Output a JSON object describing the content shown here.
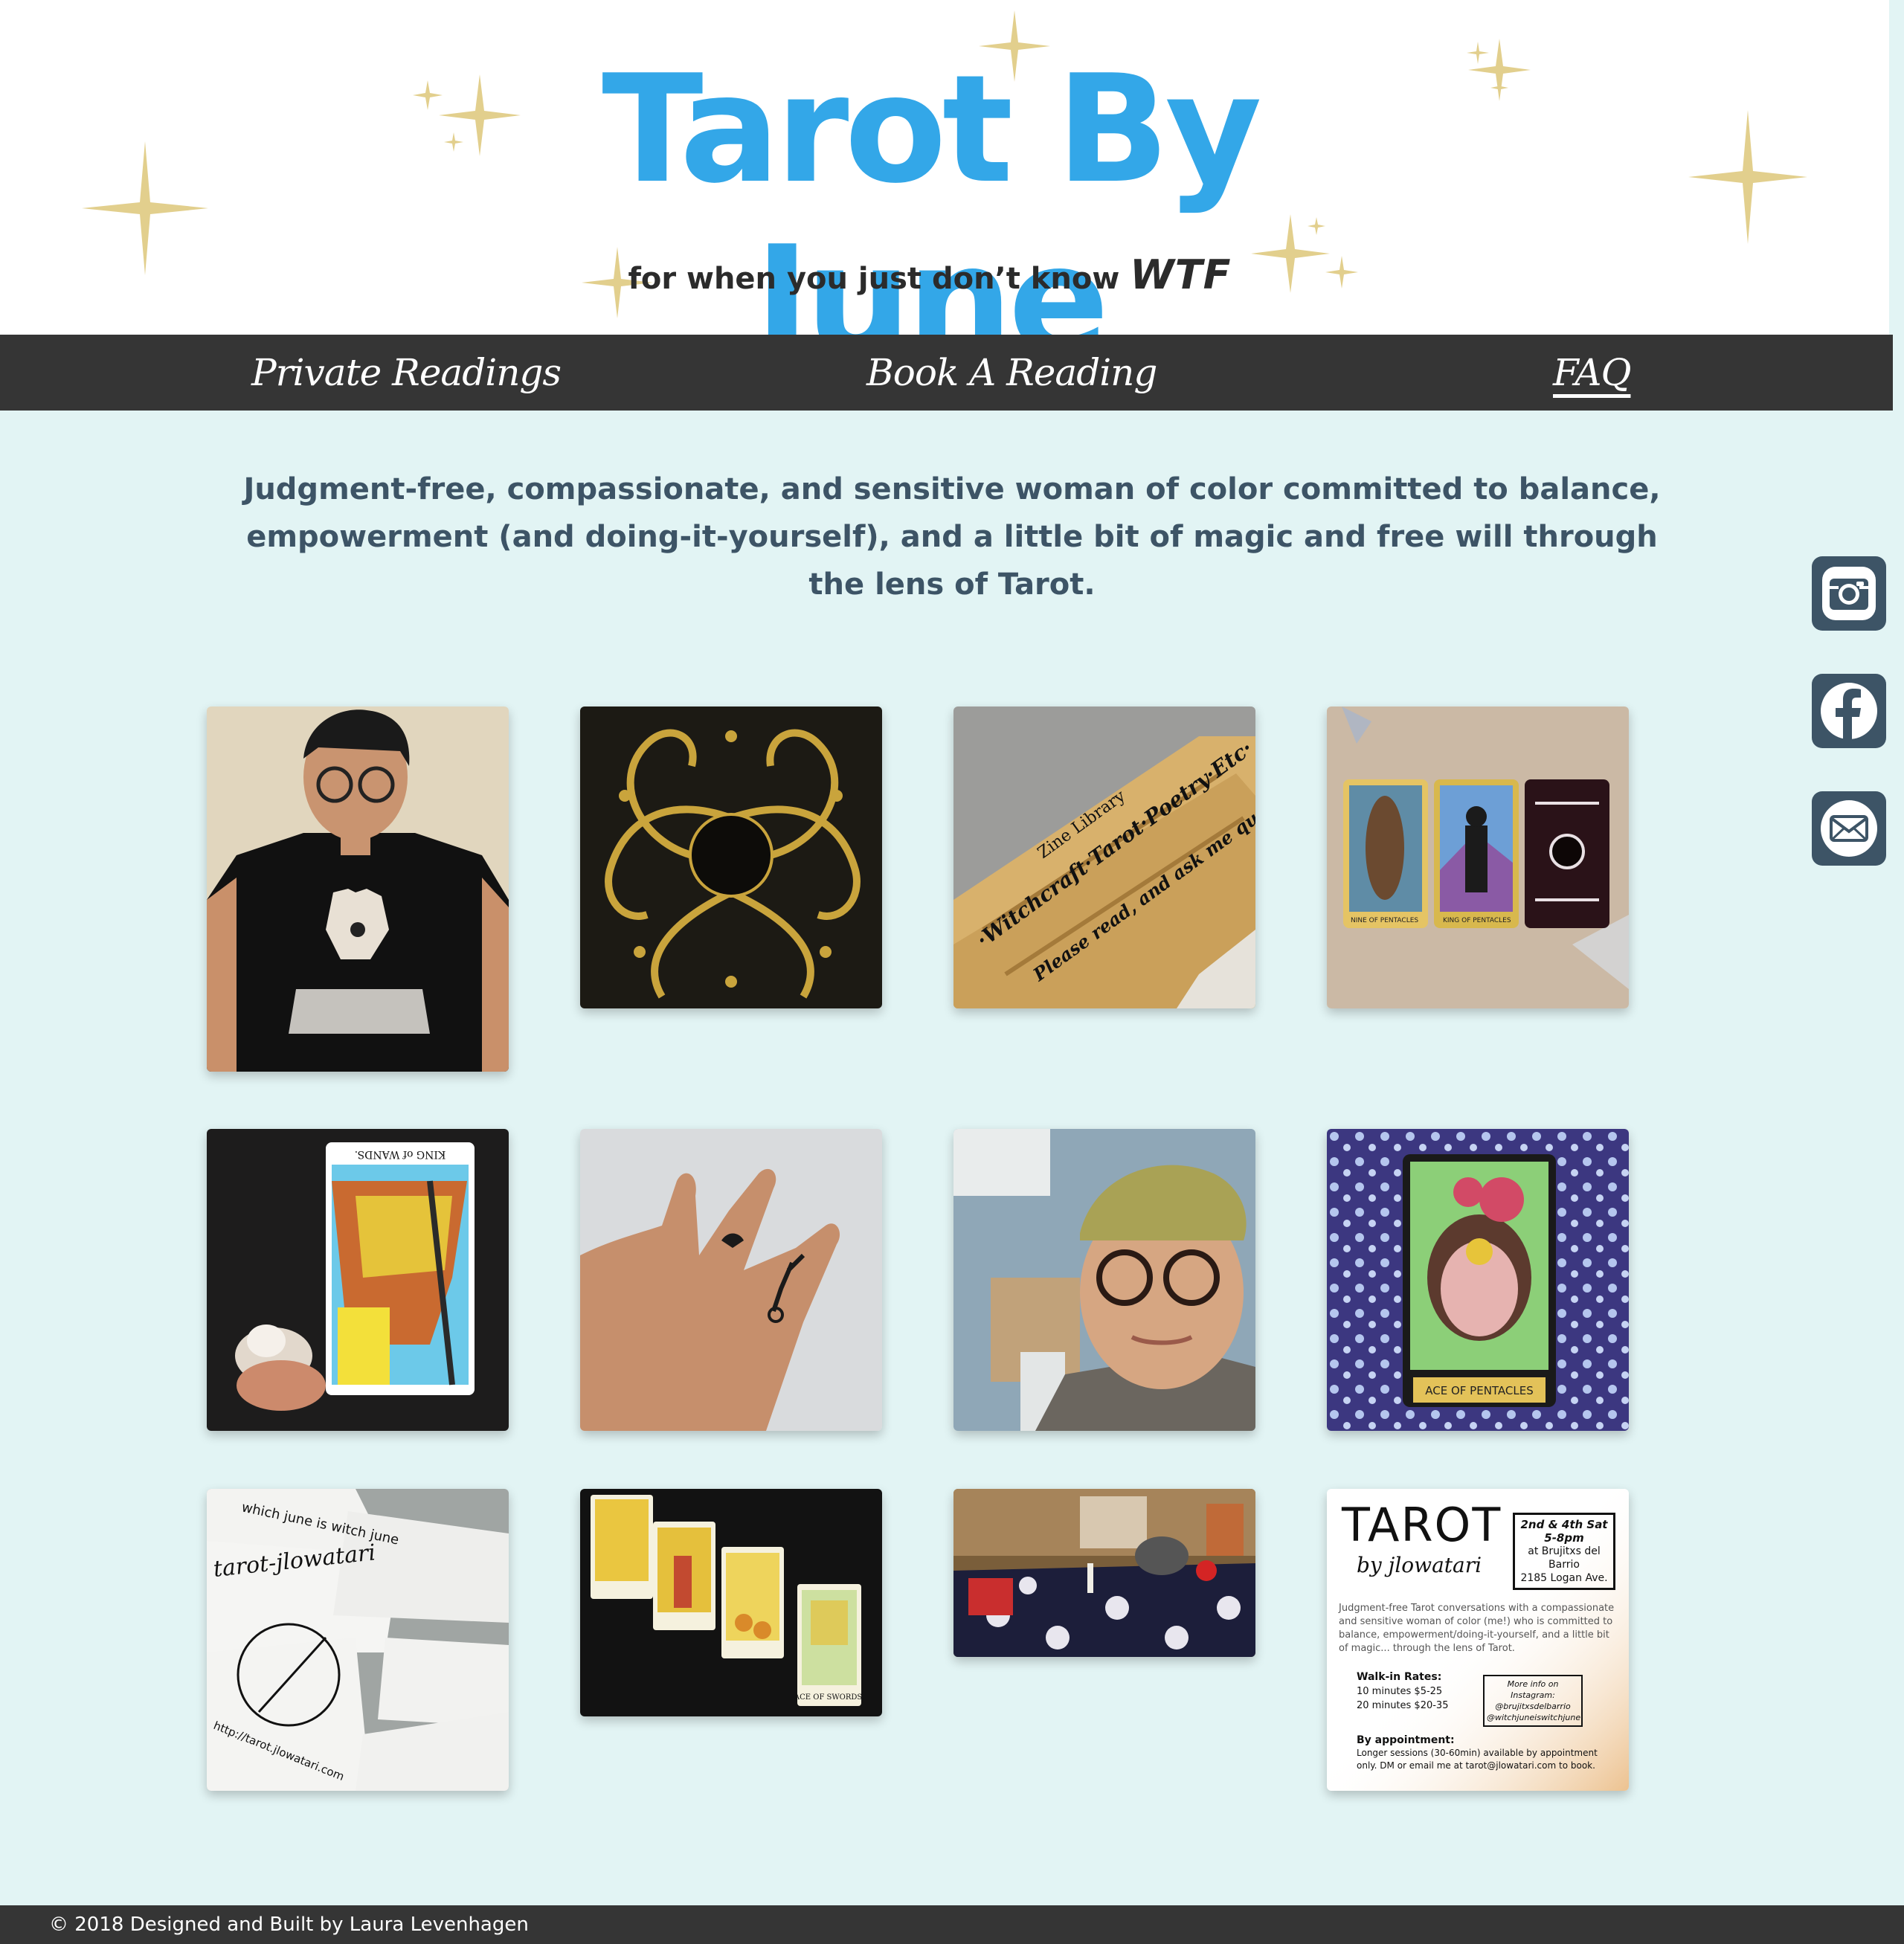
{
  "header": {
    "title": "Tarot By June",
    "tagline": "for when you just don’t know",
    "tagline_emphasis": "WTF",
    "title_color": "#33a7e8",
    "star_color": "#e2cf8d"
  },
  "nav": {
    "items": [
      {
        "label": "Private Readings"
      },
      {
        "label": "Book A Reading"
      },
      {
        "label": "FAQ"
      }
    ]
  },
  "intro": {
    "text": "Judgment-free, compassionate, and sensitive woman of color committed to balance, empowerment (and doing-it-yourself), and a little bit of magic and free will through the lens of Tarot."
  },
  "social": {
    "icons": [
      "instagram-icon",
      "facebook-icon",
      "email-icon"
    ],
    "color": "#3d5466"
  },
  "gallery": {
    "photos": [
      {
        "name": "photo-selfie-hamsa-shirt"
      },
      {
        "name": "photo-gold-card-back"
      },
      {
        "name": "photo-zine-library-sign",
        "text": [
          "Zine Library",
          "·Witchcraft·Tarot·Poetry·Etc·",
          "Please read, and ask me questions!"
        ]
      },
      {
        "name": "photo-three-cards",
        "text": [
          "NINE OF PENTACLES",
          "KING OF PENTACLES"
        ]
      },
      {
        "name": "photo-king-of-wands",
        "text": [
          "KING of WANDS."
        ]
      },
      {
        "name": "photo-finger-tattoos"
      },
      {
        "name": "photo-selfie-beanie"
      },
      {
        "name": "photo-ace-of-pentacles",
        "text": [
          "ACE OF PENTACLES"
        ]
      },
      {
        "name": "photo-business-cards",
        "text": [
          "which june is witch june",
          "tarot-jlowatari",
          "http://tarot.jlowatari.com"
        ]
      },
      {
        "name": "photo-four-cards",
        "text": [
          "ACE OF SWORDS."
        ]
      },
      {
        "name": "photo-altar"
      },
      {
        "name": "photo-event-flyer"
      }
    ],
    "flyer": {
      "title": "TAROT",
      "subtitle": "by jlowatari",
      "dates": "2nd & 4th Sat",
      "time": "5-8pm",
      "venue": "at Brujitxs del Barrio",
      "address": "2185 Logan Ave.",
      "description": "Judgment-free Tarot conversations with a compassionate and sensitive woman of color (me!) who is committed to balance, empowerment/doing-it-yourself, and a little bit of magic... through the lens of Tarot.",
      "walkin_heading": "Walk-in Rates:",
      "rate_10": "10 minutes $5-25",
      "rate_20": "20 minutes $20-35",
      "insta_heading": "More info on Instagram:",
      "insta_1": "@brujitxsdelbarrio",
      "insta_2": "@witchjuneiswitchjune",
      "appt_heading": "By appointment:",
      "appt_text": "Longer sessions (30-60min) available by appointment only. DM or email me at tarot@jlowatari.com to book."
    }
  },
  "footer": {
    "text": "© 2018 Designed and Built by Laura Levenhagen"
  }
}
